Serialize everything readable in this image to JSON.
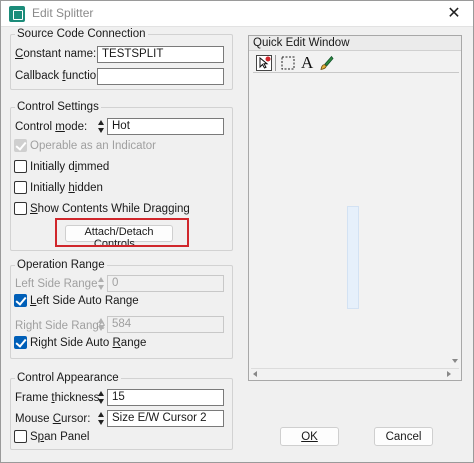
{
  "window": {
    "title": "Edit Splitter",
    "close_glyph": "✕"
  },
  "source_code": {
    "legend": "Source Code Connection",
    "constant_name_label": "Constant name:",
    "constant_name_value": "TESTSPLIT",
    "callback_label": "Callback function:",
    "callback_value": ""
  },
  "control_settings": {
    "legend": "Control Settings",
    "mode_label": "Control mode:",
    "mode_value": "Hot",
    "operable_label": "Operable as an Indicator",
    "initially_dimmed_label": "Initially dimmed",
    "initially_hidden_label": "Initially hidden",
    "show_contents_label": "Show Contents While Dragging",
    "attach_button": "Attach/Detach Controls..."
  },
  "operation_range": {
    "legend": "Operation Range",
    "left_range_label": "Left Side Range",
    "left_range_value": "0",
    "left_auto_label": "Left Side Auto Range",
    "right_range_label": "Right Side Range",
    "right_range_value": "584",
    "right_auto_label": "Right Side Auto Range"
  },
  "control_appearance": {
    "legend": "Control Appearance",
    "frame_label": "Frame thickness:",
    "frame_value": "15",
    "cursor_label": "Mouse Cursor:",
    "cursor_value": "Size E/W Cursor 2",
    "span_label": "Span Panel"
  },
  "quick_edit": {
    "title": "Quick Edit Window",
    "tools": [
      "pointer-tool-icon",
      "selection-rectangle-icon",
      "text-tool-icon",
      "color-brush-icon"
    ],
    "text_tool_glyph": "A"
  },
  "buttons": {
    "ok": "OK",
    "cancel": "Cancel"
  },
  "colors": {
    "accent_checkbox": "#005fb8",
    "highlight_border": "#d0262b",
    "app_icon": "#1c8c7a"
  }
}
